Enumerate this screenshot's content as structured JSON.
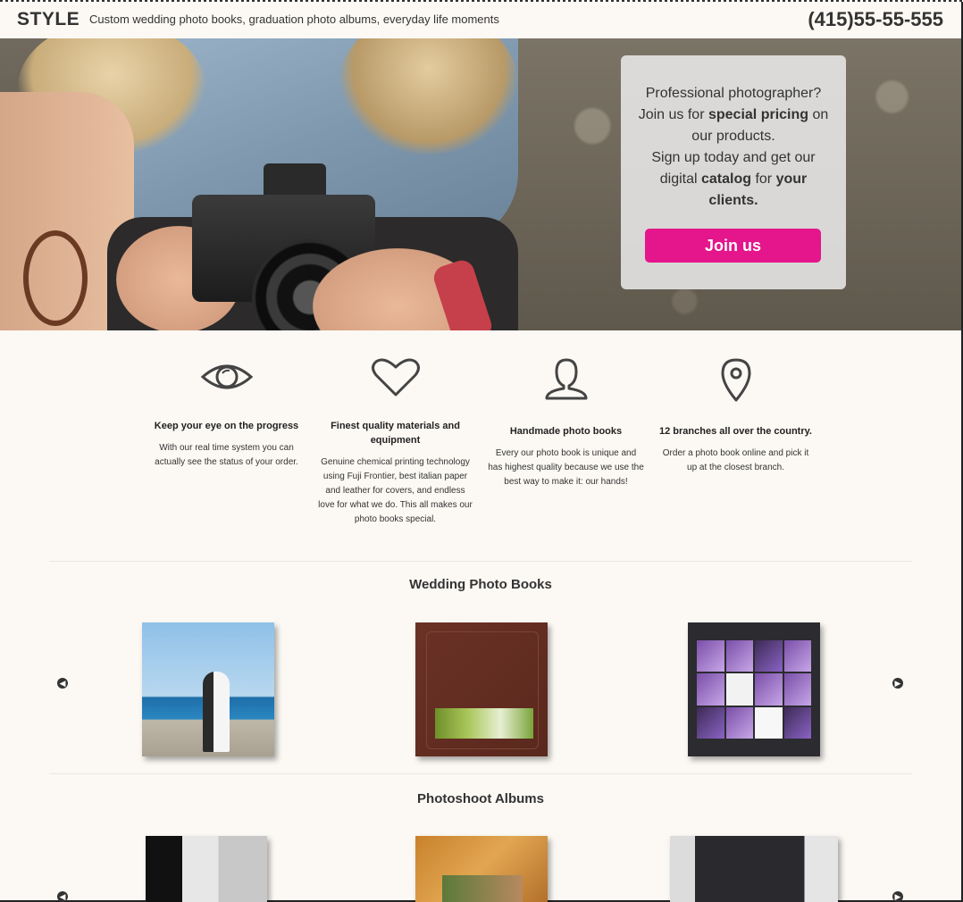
{
  "header": {
    "brand": "STYLE",
    "tagline": "Custom wedding photo books, graduation photo albums, everyday life moments",
    "phone": "(415)55-55-555"
  },
  "promo": {
    "line1": "Professional photographer?",
    "line2_pre": "Join us for ",
    "line2_bold": "special pricing",
    "line2_post": " on our products.",
    "line3": "Sign up today and get our digital ",
    "line3_bold1": "catalog",
    "line3_mid": " for ",
    "line3_bold2": "your clients.",
    "button": "Join us",
    "button_color": "#e5158b"
  },
  "features": [
    {
      "icon": "eye-icon",
      "title": "Keep your eye on the progress",
      "body": "With our real time system you can actually see the status of your order."
    },
    {
      "icon": "heart-icon",
      "title": "Finest quality materials and equipment",
      "body": "Genuine chemical printing technology using Fuji Frontier, best italian paper and leather for covers, and endless love for what we do. This all makes our photo books special."
    },
    {
      "icon": "user-icon",
      "title": "Handmade photo books",
      "body": "Every our photo book is unique and has highest quality because we use the best way to make it: our hands!"
    },
    {
      "icon": "map-pin-icon",
      "title": "12 branches all over the country.",
      "body": "Order a photo book online and pick it up at the closest branch."
    }
  ],
  "sections": [
    {
      "title": "Wedding Photo Books"
    },
    {
      "title": "Photoshoot Albums"
    }
  ],
  "carousel": {
    "prev_icon": "chevron-left-icon",
    "next_icon": "chevron-right-icon"
  }
}
